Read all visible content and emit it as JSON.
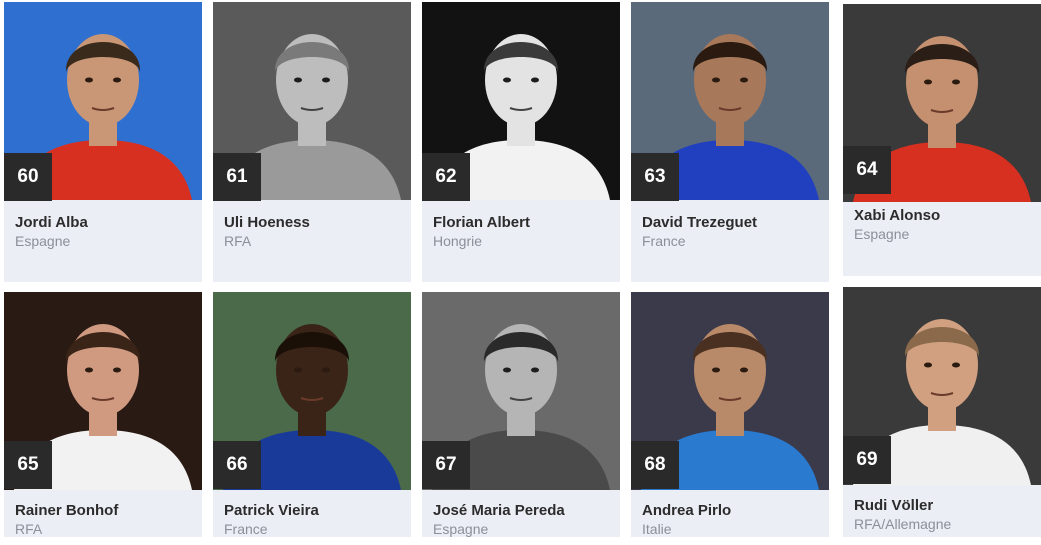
{
  "players": [
    {
      "rank": "60",
      "name": "Jordi Alba",
      "country": "Espagne",
      "photo_bg": "#2f6fd0",
      "jersey": "#d83020",
      "skin": "#c99676",
      "hair": "#3a2a1c",
      "bw": false
    },
    {
      "rank": "61",
      "name": "Uli Hoeness",
      "country": "RFA",
      "photo_bg": "#5a5a5a",
      "jersey": "#9a9a9a",
      "skin": "#bdbdbd",
      "hair": "#7a7a7a",
      "bw": true
    },
    {
      "rank": "62",
      "name": "Florian Albert",
      "country": "Hongrie",
      "photo_bg": "#121212",
      "jersey": "#f2f2f2",
      "skin": "#e3e3e3",
      "hair": "#3a3a3a",
      "bw": true
    },
    {
      "rank": "63",
      "name": "David Trezeguet",
      "country": "France",
      "photo_bg": "#5a6a7a",
      "jersey": "#2040c0",
      "skin": "#a8785a",
      "hair": "#2a1a10",
      "bw": false
    },
    {
      "rank": "64",
      "name": "Xabi Alonso",
      "country": "Espagne",
      "photo_bg": "#3a3a3a",
      "jersey": "#d83020",
      "skin": "#c49070",
      "hair": "#2a1e16",
      "bw": false
    },
    {
      "rank": "65",
      "name": "Rainer Bonhof",
      "country": "RFA",
      "photo_bg": "#2a1a14",
      "jersey": "#f2f2f2",
      "skin": "#d09a80",
      "hair": "#3a2418",
      "bw": false
    },
    {
      "rank": "66",
      "name": "Patrick Vieira",
      "country": "France",
      "photo_bg": "#4a6a4a",
      "jersey": "#1a3a9a",
      "skin": "#3a2418",
      "hair": "#1a1008",
      "bw": false
    },
    {
      "rank": "67",
      "name": "José Maria Pereda",
      "country": "Espagne",
      "photo_bg": "#6a6a6a",
      "jersey": "#4a4a4a",
      "skin": "#b5b5b5",
      "hair": "#2a2a2a",
      "bw": true
    },
    {
      "rank": "68",
      "name": "Andrea Pirlo",
      "country": "Italie",
      "photo_bg": "#3a3a4a",
      "jersey": "#2a7ad0",
      "skin": "#b88a6a",
      "hair": "#4a3020",
      "bw": false
    },
    {
      "rank": "69",
      "name": "Rudi Völler",
      "country": "RFA/Allemagne",
      "photo_bg": "#3a3a3a",
      "jersey": "#f0f0f0",
      "skin": "#d0a080",
      "hair": "#8a6a4a",
      "bw": false
    }
  ]
}
